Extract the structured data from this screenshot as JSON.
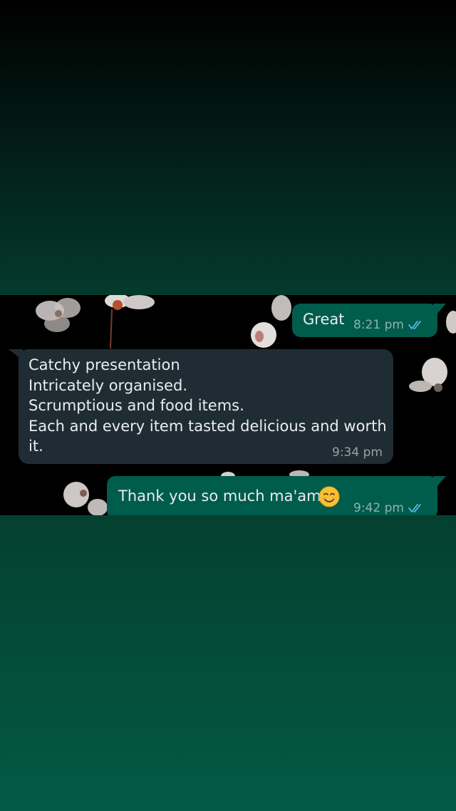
{
  "colors": {
    "outgoing_bubble": "#005c4b",
    "incoming_bubble": "#202c33",
    "read_tick": "#53bdeb",
    "timestamp": "#aebac1"
  },
  "messages": [
    {
      "direction": "outgoing",
      "text": "Great",
      "time": "8:21 pm",
      "status_icon": "double-check-read-icon"
    },
    {
      "direction": "incoming",
      "text": "Catchy presentation\nIntricately organised.\nScrumptious and food items.\nEach and every item tasted delicious and worth\nit.",
      "time": "9:34 pm"
    },
    {
      "direction": "outgoing",
      "text": "Thank you so much ma'am",
      "emoji": "smiling-face-icon",
      "time": "9:42 pm",
      "status_icon": "double-check-read-icon"
    }
  ]
}
